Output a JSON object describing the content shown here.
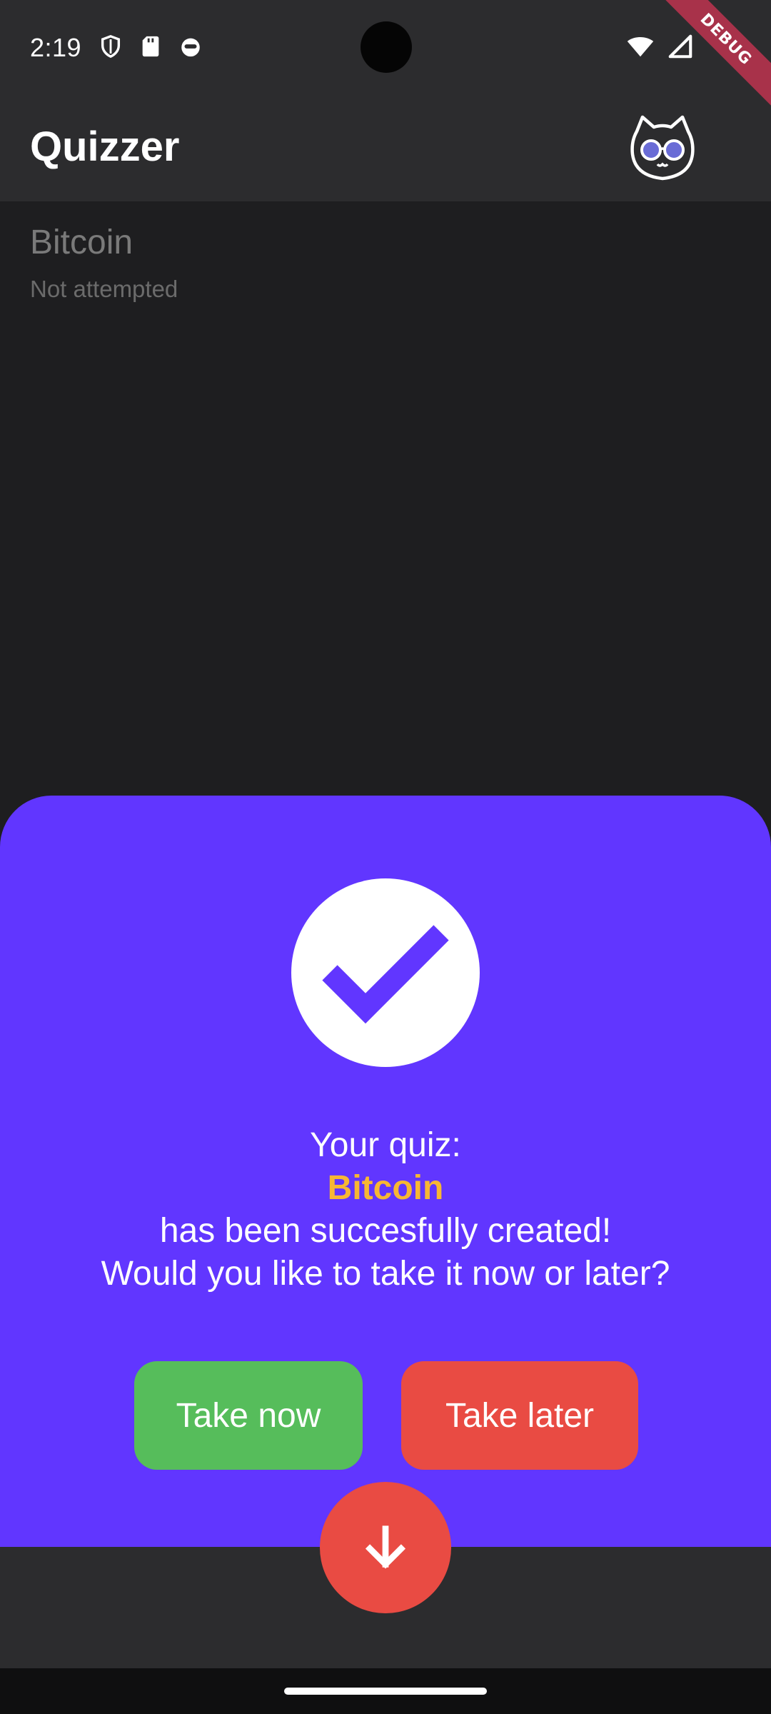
{
  "status_bar": {
    "time": "2:19",
    "left_icons": [
      "shield-icon",
      "sd-card-icon",
      "cat-face-icon"
    ],
    "right_icons": [
      "wifi-icon",
      "cell-signal-icon"
    ]
  },
  "debug_banner": "DEBUG",
  "app_bar": {
    "title": "Quizzer",
    "avatar_icon": "owl-cat-glasses-icon"
  },
  "quiz_list": [
    {
      "title": "Bitcoin",
      "status": "Not attempted"
    }
  ],
  "modal": {
    "icon": "check-icon",
    "line1": "Your quiz:",
    "quiz_name": "Bitcoin",
    "line3": "has been succesfully created!",
    "line4": "Would you like to take it now or later?",
    "take_now_label": "Take now",
    "take_later_label": "Take later"
  },
  "fab": {
    "icon": "arrow-down-icon"
  },
  "colors": {
    "sheet": "#6136ff",
    "highlight": "#f7b733",
    "take_now": "#56bd5b",
    "take_later": "#e94b43",
    "fab": "#e94b43",
    "surface": "#2c2c2e"
  }
}
